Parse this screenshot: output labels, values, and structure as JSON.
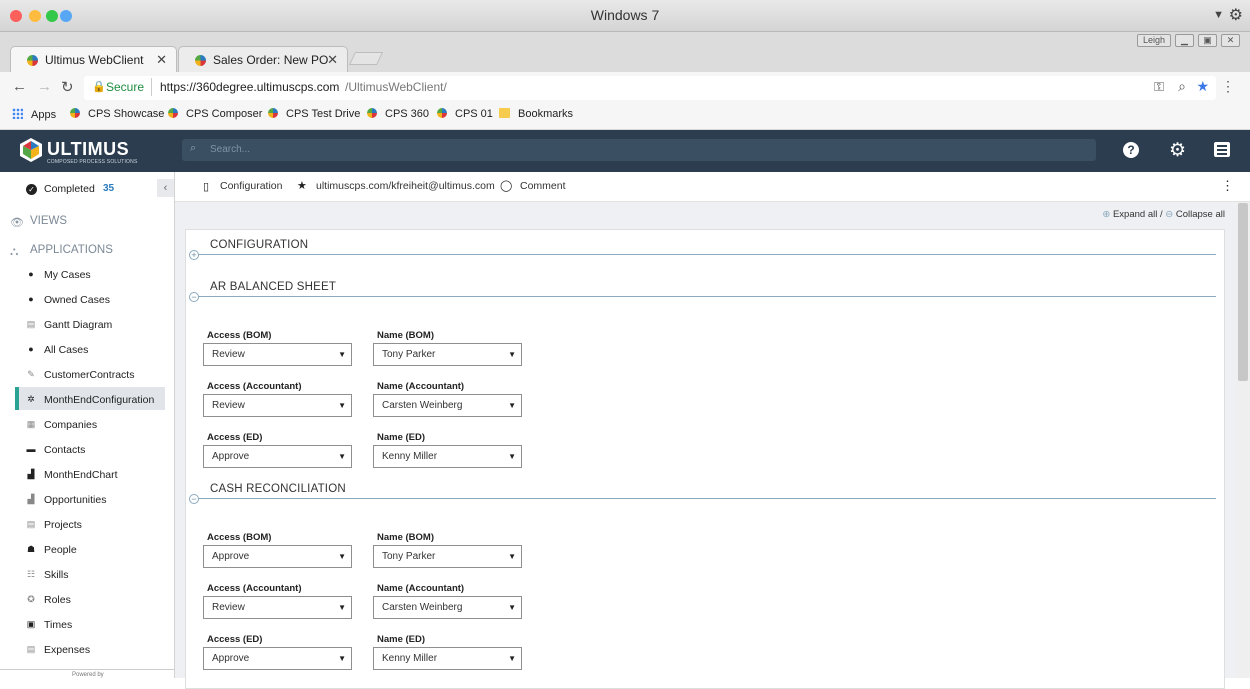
{
  "os": {
    "window_title": "Windows 7"
  },
  "browser": {
    "tabs": [
      {
        "label": "Ultimus WebClient",
        "active": true
      },
      {
        "label": "Sales Order: New PO",
        "active": false
      }
    ],
    "user_badge": "Leigh",
    "secure_label": "Secure",
    "url_main": "https://360degree.ultimuscps.com",
    "url_path": "/UltimusWebClient/",
    "bookmarks": [
      "Apps",
      "CPS Showcase",
      "CPS Composer",
      "CPS Test Drive",
      "CPS 360",
      "CPS 01",
      "Bookmarks"
    ]
  },
  "app": {
    "logo_text": "ULTIMUS",
    "logo_sub": "COMPOSED PROCESS SOLUTIONS",
    "search_placeholder": "Search...",
    "accent": "#2b3d4f"
  },
  "sidebar": {
    "completed_label": "Completed",
    "completed_count": "35",
    "views_label": "VIEWS",
    "applications_label": "APPLICATIONS",
    "items": [
      {
        "label": "My Cases",
        "icon": "case-icon"
      },
      {
        "label": "Owned Cases",
        "icon": "case-icon"
      },
      {
        "label": "Gantt Diagram",
        "icon": "gantt-icon"
      },
      {
        "label": "All Cases",
        "icon": "case-icon"
      },
      {
        "label": "CustomerContracts",
        "icon": "contract-icon"
      },
      {
        "label": "MonthEndConfiguration",
        "icon": "config-icon",
        "selected": true
      },
      {
        "label": "Companies",
        "icon": "building-icon"
      },
      {
        "label": "Contacts",
        "icon": "contact-icon"
      },
      {
        "label": "MonthEndChart",
        "icon": "chart-icon"
      },
      {
        "label": "Opportunities",
        "icon": "opportunity-icon"
      },
      {
        "label": "Projects",
        "icon": "project-icon"
      },
      {
        "label": "People",
        "icon": "people-icon"
      },
      {
        "label": "Skills",
        "icon": "skills-icon"
      },
      {
        "label": "Roles",
        "icon": "roles-icon"
      },
      {
        "label": "Times",
        "icon": "times-icon"
      },
      {
        "label": "Expenses",
        "icon": "expenses-icon"
      }
    ],
    "powered_by": "Powered by"
  },
  "content_bar": {
    "configuration": "Configuration",
    "user": "ultimuscps.com/kfreiheit@ultimus.com",
    "comment": "Comment"
  },
  "panel": {
    "expand_all": "Expand all",
    "separator": "/",
    "collapse_all": "Collapse all",
    "sections": [
      {
        "title": "CONFIGURATION",
        "collapsed": true,
        "rows": []
      },
      {
        "title": "AR BALANCED SHEET",
        "collapsed": false,
        "rows": [
          {
            "access_label": "Access (BOM)",
            "access_value": "Review",
            "name_label": "Name (BOM)",
            "name_value": "Tony Parker"
          },
          {
            "access_label": "Access (Accountant)",
            "access_value": "Review",
            "name_label": "Name (Accountant)",
            "name_value": "Carsten Weinberg"
          },
          {
            "access_label": "Access (ED)",
            "access_value": "Approve",
            "name_label": "Name (ED)",
            "name_value": "Kenny Miller"
          }
        ]
      },
      {
        "title": "CASH RECONCILIATION",
        "collapsed": false,
        "rows": [
          {
            "access_label": "Access (BOM)",
            "access_value": "Approve",
            "name_label": "Name (BOM)",
            "name_value": "Tony Parker"
          },
          {
            "access_label": "Access (Accountant)",
            "access_value": "Review",
            "name_label": "Name (Accountant)",
            "name_value": "Carsten Weinberg"
          },
          {
            "access_label": "Access (ED)",
            "access_value": "Approve",
            "name_label": "Name (ED)",
            "name_value": "Kenny Miller"
          }
        ]
      }
    ]
  }
}
